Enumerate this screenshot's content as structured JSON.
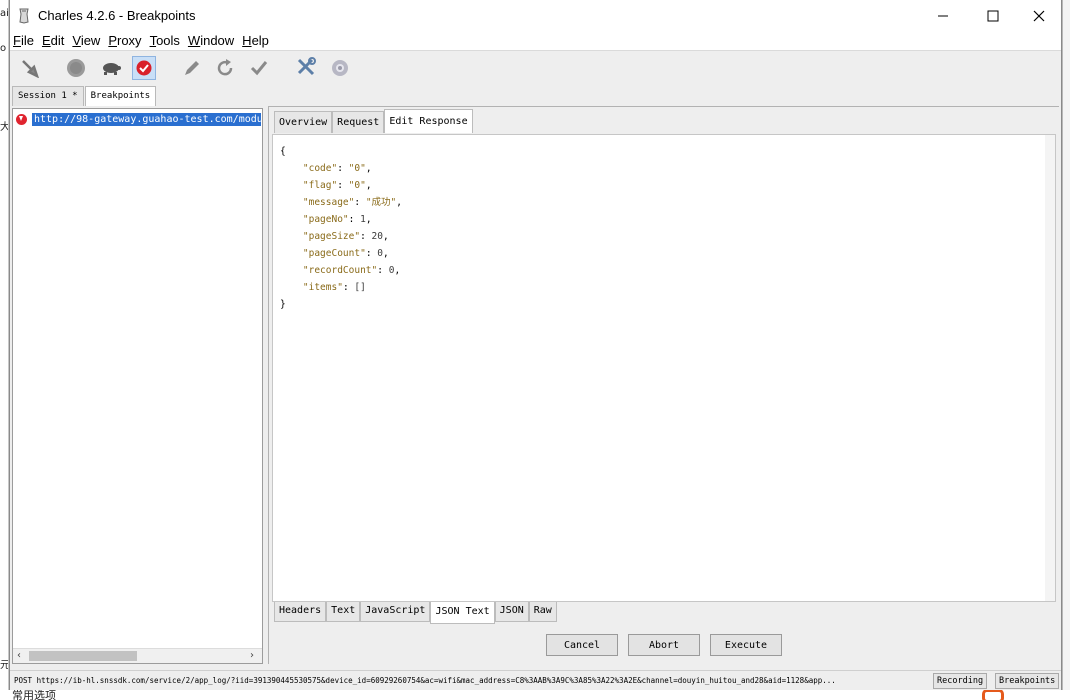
{
  "window": {
    "title": "Charles 4.2.6 - Breakpoints"
  },
  "menu": [
    "File",
    "Edit",
    "View",
    "Proxy",
    "Tools",
    "Window",
    "Help"
  ],
  "menu_mnemonics": [
    "F",
    "E",
    "V",
    "P",
    "T",
    "W",
    "H"
  ],
  "toolbar": {
    "icons": [
      "broom-icon",
      "record-icon",
      "throttle-turtle-icon",
      "breakpoints-icon",
      "pen-icon",
      "refresh-icon",
      "validate-check-icon",
      "tools-icon",
      "settings-gear-icon"
    ],
    "active": "breakpoints-icon"
  },
  "session_tabs": [
    {
      "label": "Session 1 *",
      "selected": false
    },
    {
      "label": "Breakpoints",
      "selected": true
    }
  ],
  "tree": {
    "url": "http://98-gateway.guahao-test.com/modu"
  },
  "top_tabs": [
    {
      "label": "Overview",
      "selected": false
    },
    {
      "label": "Request",
      "selected": false
    },
    {
      "label": "Edit Response",
      "selected": true
    }
  ],
  "json_body": {
    "open": "{",
    "close": "}",
    "lines": [
      {
        "key": "\"code\"",
        "value": "\"0\"",
        "comma": ","
      },
      {
        "key": "\"flag\"",
        "value": "\"0\"",
        "comma": ","
      },
      {
        "key": "\"message\"",
        "value": "\"成功\"",
        "comma": ","
      },
      {
        "key": "\"pageNo\"",
        "value": "1",
        "comma": ","
      },
      {
        "key": "\"pageSize\"",
        "value": "20",
        "comma": ","
      },
      {
        "key": "\"pageCount\"",
        "value": "0",
        "comma": ","
      },
      {
        "key": "\"recordCount\"",
        "value": "0",
        "comma": ","
      },
      {
        "key": "\"items\"",
        "value": "[]",
        "comma": ""
      }
    ]
  },
  "bottom_tabs": [
    {
      "label": "Headers",
      "selected": false
    },
    {
      "label": "Text",
      "selected": false
    },
    {
      "label": "JavaScript",
      "selected": false
    },
    {
      "label": "JSON Text",
      "selected": true
    },
    {
      "label": "JSON",
      "selected": false
    },
    {
      "label": "Raw",
      "selected": false
    }
  ],
  "buttons": {
    "cancel": "Cancel",
    "abort": "Abort",
    "execute": "Execute"
  },
  "status": {
    "text": "POST https://ib-hl.snssdk.com/service/2/app_log/?iid=391390445530575&device_id=60929260754&ac=wifi&mac_address=C8%3AAB%3A9C%3A85%3A22%3A2E&channel=douyin_huitou_and28&aid=1128&app...",
    "recording": "Recording",
    "breakpoints": "Breakpoints"
  },
  "background": {
    "bottom_text": "常用选项",
    "left_fragments": [
      "ai",
      "大",
      "o",
      "元"
    ]
  },
  "colors": {
    "selection": "#2a6fd0",
    "breakpoint_red": "#e0242f",
    "json_key": "#8a6b1a"
  }
}
